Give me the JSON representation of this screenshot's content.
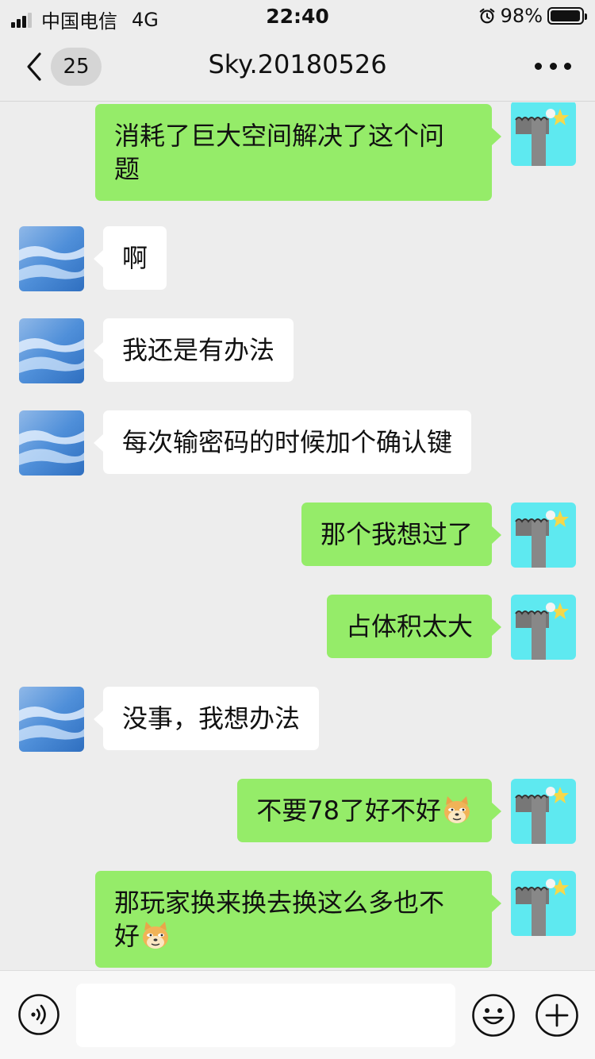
{
  "status_bar": {
    "carrier": "中国电信",
    "network": "4G",
    "time": "22:40",
    "battery": "98%",
    "battery_level": 0.98
  },
  "nav": {
    "back_count": "25",
    "title": "Sky.20180526"
  },
  "messages": [
    {
      "side": "out",
      "text": "消耗了巨大空间解决了这个问",
      "text2": "题"
    },
    {
      "side": "in",
      "text": "啊"
    },
    {
      "side": "in",
      "text": "我还是有办法"
    },
    {
      "side": "in",
      "text": "每次输密码的时候加个确认键"
    },
    {
      "side": "out",
      "text": "那个我想过了"
    },
    {
      "side": "out",
      "text": "占体积太大"
    },
    {
      "side": "in",
      "text": "没事，我想办法"
    },
    {
      "side": "out",
      "text": "不要78了好不好",
      "emoji": "doge-emoji"
    },
    {
      "side": "out",
      "text": "那玩家换来换去换这么多也不",
      "text2": "好",
      "emoji": "doge-emoji"
    }
  ],
  "input": {
    "value": "",
    "placeholder": ""
  },
  "icons": {
    "back": "chevron-left-icon",
    "more": "more-dots-icon",
    "voice": "voice-icon",
    "emoji": "smiley-icon",
    "plus": "plus-icon",
    "alarm": "alarm-icon"
  },
  "colors": {
    "outgoing_bubble": "#95ec69",
    "incoming_bubble": "#ffffff",
    "background": "#ededed"
  }
}
